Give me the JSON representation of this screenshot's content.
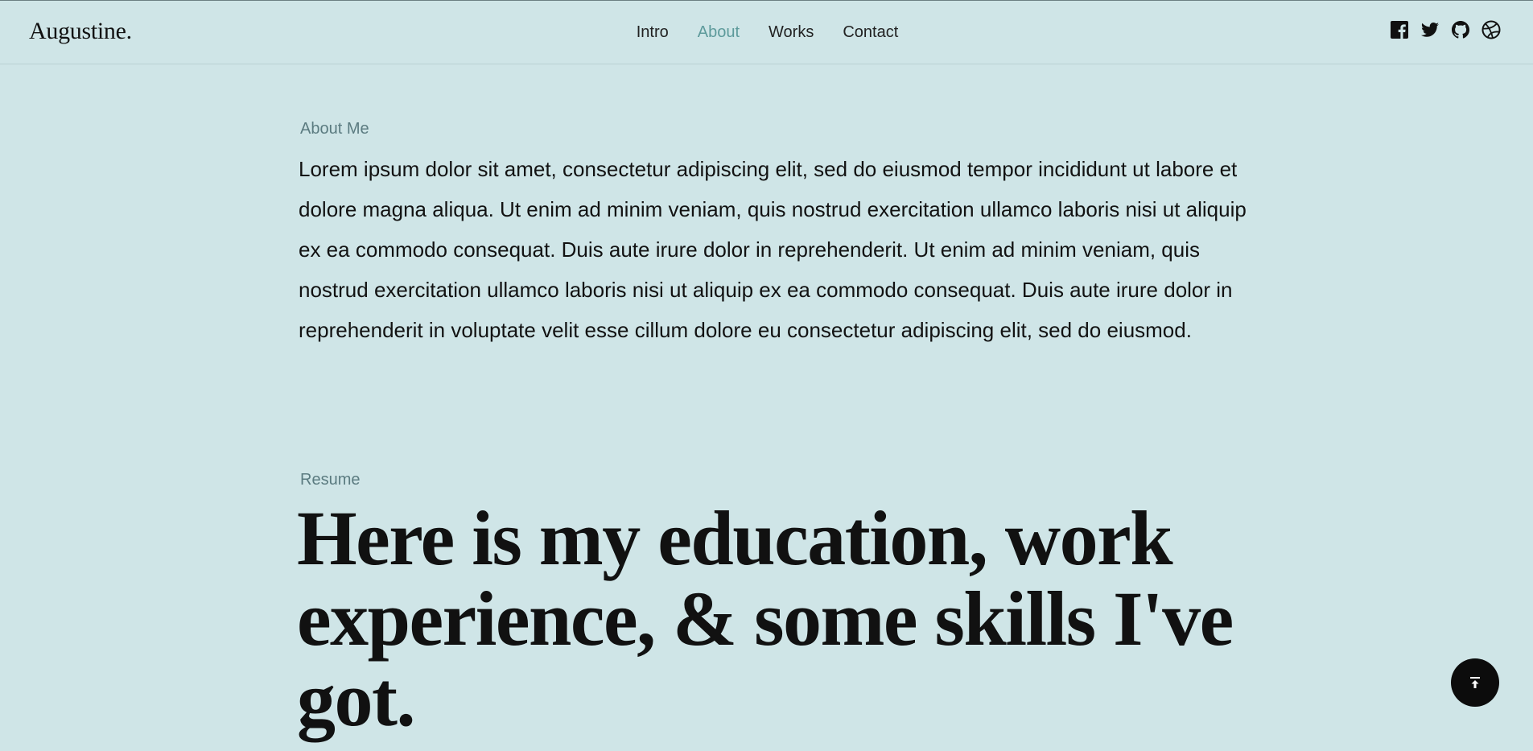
{
  "header": {
    "logo": "Augustine.",
    "nav": [
      {
        "label": "Intro",
        "active": false
      },
      {
        "label": "About",
        "active": true
      },
      {
        "label": "Works",
        "active": false
      },
      {
        "label": "Contact",
        "active": false
      }
    ],
    "social_icons": [
      "facebook-icon",
      "twitter-icon",
      "github-icon",
      "dribbble-icon"
    ]
  },
  "about": {
    "label": "About Me",
    "text": "Lorem ipsum dolor sit amet, consectetur adipiscing elit, sed do eiusmod tempor incididunt ut labore et dolore magna aliqua. Ut enim ad minim veniam, quis nostrud exercitation ullamco laboris nisi ut aliquip ex ea commodo consequat. Duis aute irure dolor in reprehenderit. Ut enim ad minim veniam, quis nostrud exercitation ullamco laboris nisi ut aliquip ex ea commodo consequat. Duis aute irure dolor in reprehenderit in voluptate velit esse cillum dolore eu consectetur adipiscing elit, sed do eiusmod."
  },
  "resume": {
    "label": "Resume",
    "heading": "Here is my education, work experience, & some skills I've got."
  },
  "colors": {
    "background": "#cfe5e7",
    "accent": "#5d9a9b",
    "label": "#5b7b80",
    "text": "#111111"
  },
  "scroll_top_icon": "arrow-up-to-top-icon"
}
